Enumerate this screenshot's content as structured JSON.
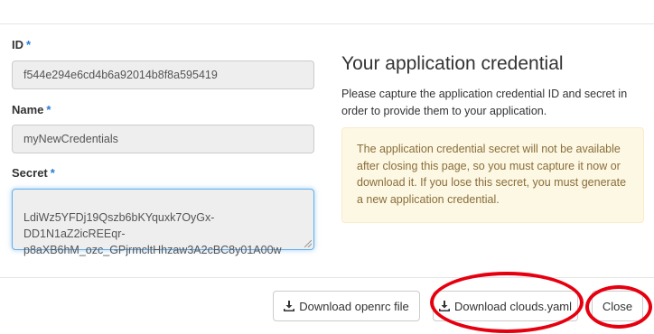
{
  "form": {
    "id": {
      "label": "ID",
      "required_marker": "*",
      "value": "f544e294e6cd4b6a92014b8f8a595419"
    },
    "name": {
      "label": "Name",
      "required_marker": "*",
      "value": "myNewCredentials"
    },
    "secret": {
      "label": "Secret",
      "required_marker": "*",
      "value": "LdiWz5YFDj19Qszb6bKYquxk7OyGx-\nDD1N1aZ2icREEqr-\np8aXB6hM_ozc_GPjrmcltHhzaw3A2cBC8y01A00w"
    }
  },
  "info": {
    "title": "Your application credential",
    "description": "Please capture the application credential ID and secret in order to provide them to your application.",
    "warning": "The application credential secret will not be available after closing this page, so you must capture it now or download it. If you lose this secret, you must generate a new application credential."
  },
  "footer": {
    "download_openrc_label": "Download openrc file",
    "download_clouds_label": "Download clouds.yaml",
    "close_label": "Close"
  },
  "icons": {
    "download": "download-icon"
  },
  "colors": {
    "required_marker": "#2a7ad6",
    "warning_bg": "#fcf8e3",
    "warning_text": "#8a6d3b",
    "annotation_ring": "#e6000f",
    "focus_border": "#66afe9"
  }
}
